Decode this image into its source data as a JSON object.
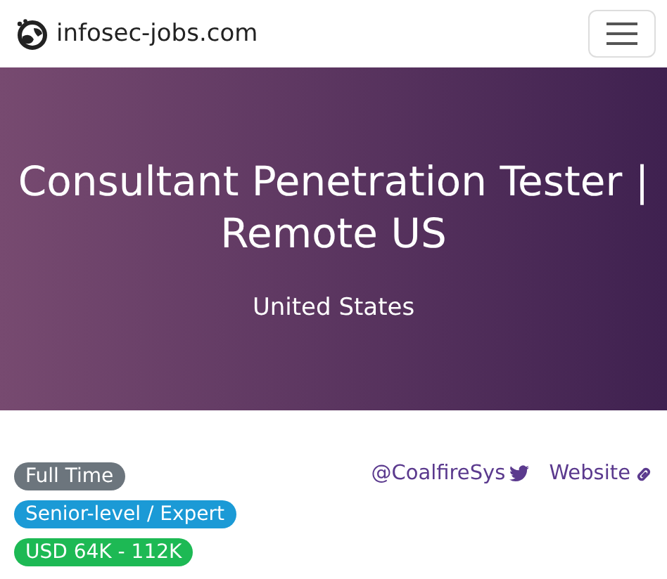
{
  "navbar": {
    "brand": "infosec-jobs.com"
  },
  "hero": {
    "title": "Consultant Penetration Tester | Remote US",
    "location": "United States"
  },
  "badges": [
    {
      "label": "Full Time",
      "color": "#6c757d"
    },
    {
      "label": "Senior-level / Expert",
      "color": "#1b9ad6"
    },
    {
      "label": "USD 64K - 112K",
      "color": "#1db954"
    }
  ],
  "links": [
    {
      "label": "@CoalfireSys",
      "kind": "twitter"
    },
    {
      "label": "Website",
      "kind": "link"
    }
  ]
}
